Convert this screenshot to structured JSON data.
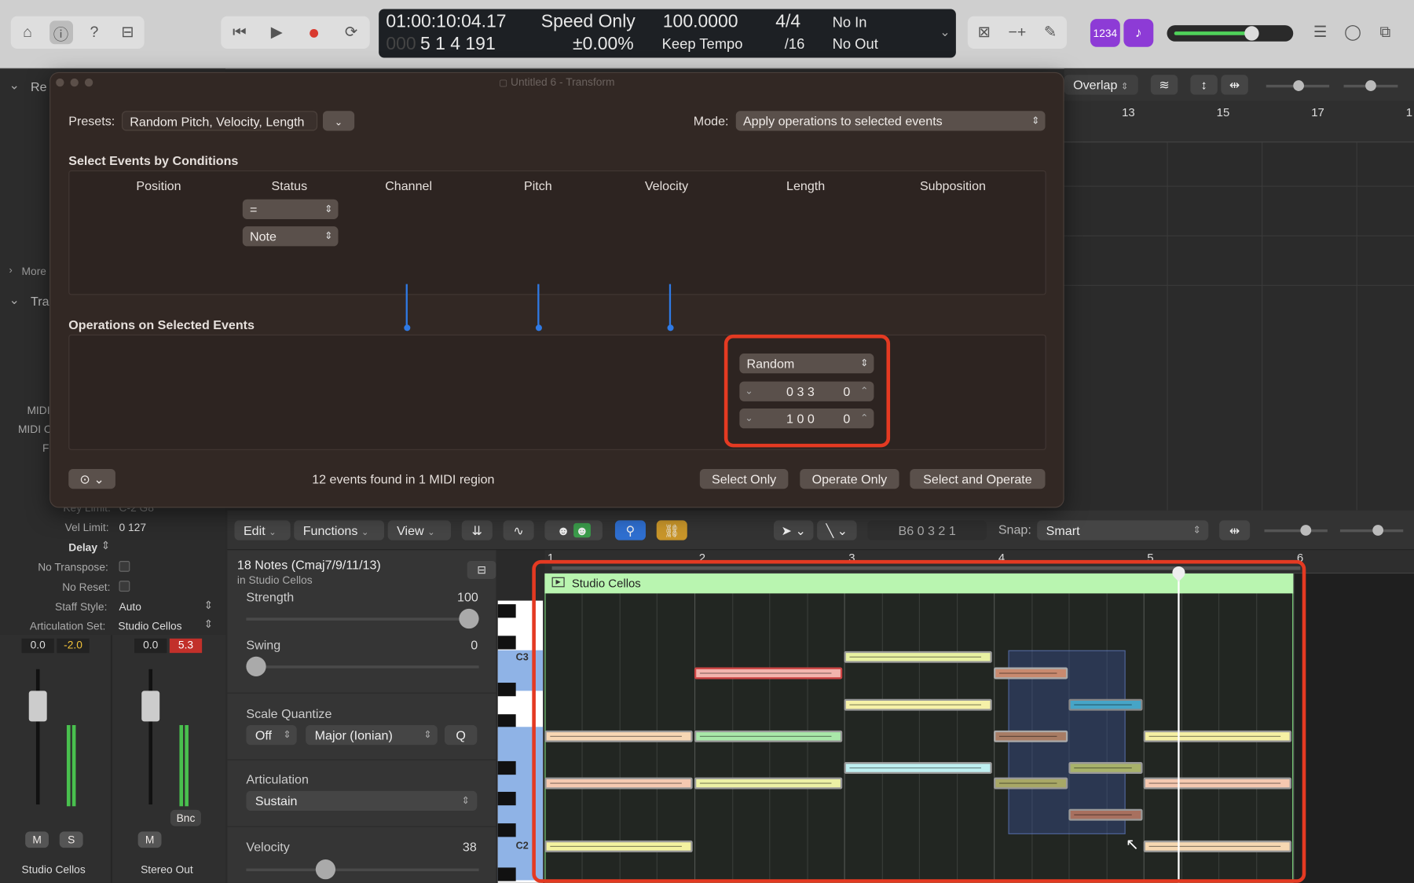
{
  "transport": {
    "time": "01:00:10:04.17",
    "bars": "5 1 4 191",
    "bars_dim": "000",
    "mode": "Speed Only",
    "pitch": "±0.00%",
    "tempo": "100.0000",
    "keep": "Keep Tempo",
    "sig": "4/4",
    "div": "/16",
    "in": "No In",
    "out": "No Out",
    "cpu": "1234"
  },
  "dialog": {
    "title": "Untitled 6 - Transform",
    "presets_label": "Presets:",
    "preset": "Random Pitch, Velocity, Length",
    "mode_label": "Mode:",
    "mode": "Apply operations to selected events",
    "conditions_title": "Select Events by Conditions",
    "columns": [
      "Position",
      "Status",
      "Channel",
      "Pitch",
      "Velocity",
      "Length",
      "Subposition"
    ],
    "status_op": "=",
    "status_value": "Note",
    "ops_title": "Operations on Selected Events",
    "length_op": "Random",
    "length_v1": "0 3 3",
    "length_v1b": "0",
    "length_v2": "1 0 0",
    "length_v2b": "0",
    "found": "12 events found in 1 MIDI region",
    "btn_select": "Select Only",
    "btn_operate": "Operate Only",
    "btn_both": "Select and Operate"
  },
  "arrange": {
    "overlap": "Overlap",
    "bars": [
      "13",
      "15",
      "17",
      "1"
    ]
  },
  "inspector": {
    "sec1": "Re",
    "more": "More",
    "sec2": "Tra",
    "midi1": "MIDI",
    "midi2": "MIDI C",
    "f": "F",
    "key_limit_label": "Key Limit:",
    "key_limit": "C-2 G8",
    "vel_limit_label": "Vel Limit:",
    "vel_limit": "0  127",
    "delay_label": "Delay",
    "no_transpose": "No Transpose:",
    "no_reset": "No Reset:",
    "staff_label": "Staff Style:",
    "staff": "Auto",
    "artic_label": "Articulation Set:",
    "artic": "Studio Cellos",
    "strip1_vol": "0.0",
    "strip1_pan": "-2.0",
    "strip2_vol": "0.0",
    "strip2_pan": "5.3",
    "bnc": "Bnc",
    "m": "M",
    "s": "S",
    "m2": "M",
    "strip1_name": "Studio Cellos",
    "strip2_name": "Stereo Out"
  },
  "editor": {
    "edit": "Edit",
    "functions": "Functions",
    "view": "View",
    "position": "B6  0 3 2 1",
    "snap_label": "Snap:",
    "snap": "Smart",
    "region_title": "18 Notes (Cmaj7/9/11/13)",
    "region_sub": "in Studio Cellos",
    "strength_label": "Strength",
    "strength": "100",
    "strength_value": 1.0,
    "swing_label": "Swing",
    "swing": "0",
    "swing_value": 0,
    "sq_label": "Scale Quantize",
    "sq_off": "Off",
    "sq_scale": "Major (Ionian)",
    "q": "Q",
    "artic_label": "Articulation",
    "artic": "Sustain",
    "velocity_label": "Velocity",
    "velocity": "38",
    "velocity_value": 0.3,
    "region_name": "Studio Cellos",
    "ruler": [
      "1",
      "2",
      "3",
      "4",
      "5",
      "6"
    ],
    "keys": [
      "C3",
      "C2"
    ]
  },
  "colors": {
    "accent_red": "#e43a22",
    "region_green": "#b9f5b0",
    "playhead": "#ffffff"
  }
}
